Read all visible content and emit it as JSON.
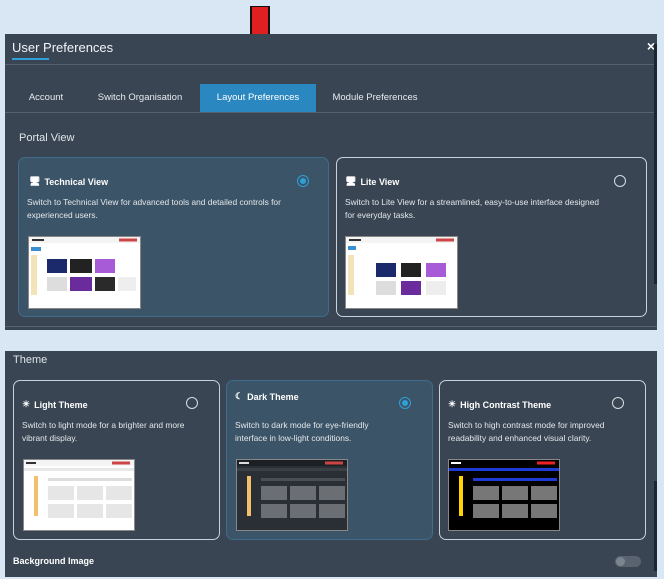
{
  "dialog": {
    "title": "User Preferences",
    "close_symbol": "×"
  },
  "tabs": [
    {
      "label": "Account",
      "active": false
    },
    {
      "label": "Switch Organisation",
      "active": false
    },
    {
      "label": "Layout Preferences",
      "active": true
    },
    {
      "label": "Module Preferences",
      "active": false
    }
  ],
  "portal_view": {
    "label": "Portal View",
    "options": [
      {
        "name": "Technical View",
        "desc_line1": "Switch to Technical View for advanced tools and detailed controls for",
        "desc_line2": "experienced users.",
        "selected": true,
        "icon": "monitor-icon"
      },
      {
        "name": "Lite View",
        "desc_line1": "Switch to Lite View for a streamlined, easy-to-use interface designed",
        "desc_line2": "for everyday tasks.",
        "selected": false,
        "icon": "monitor-icon"
      }
    ]
  },
  "theme": {
    "label": "Theme",
    "options": [
      {
        "name": "Light Theme",
        "desc_line1": "Switch to light mode for a brighter and more",
        "desc_line2": "vibrant display.",
        "selected": false,
        "icon": "sun-icon"
      },
      {
        "name": "Dark Theme",
        "desc_line1": "Switch to dark mode for eye-friendly",
        "desc_line2": "interface in low-light conditions.",
        "selected": true,
        "icon": "moon-icon"
      },
      {
        "name": "High Contrast Theme",
        "desc_line1": "Switch to high contrast mode for improved",
        "desc_line2": "readability and enhanced visual clarity.",
        "selected": false,
        "icon": "sun-icon"
      }
    ]
  },
  "background_image": {
    "label": "Background Image",
    "enabled": false
  },
  "colors": {
    "accent": "#2e9fd8",
    "panel": "#394552",
    "annotation_arrow": "#e02020"
  }
}
